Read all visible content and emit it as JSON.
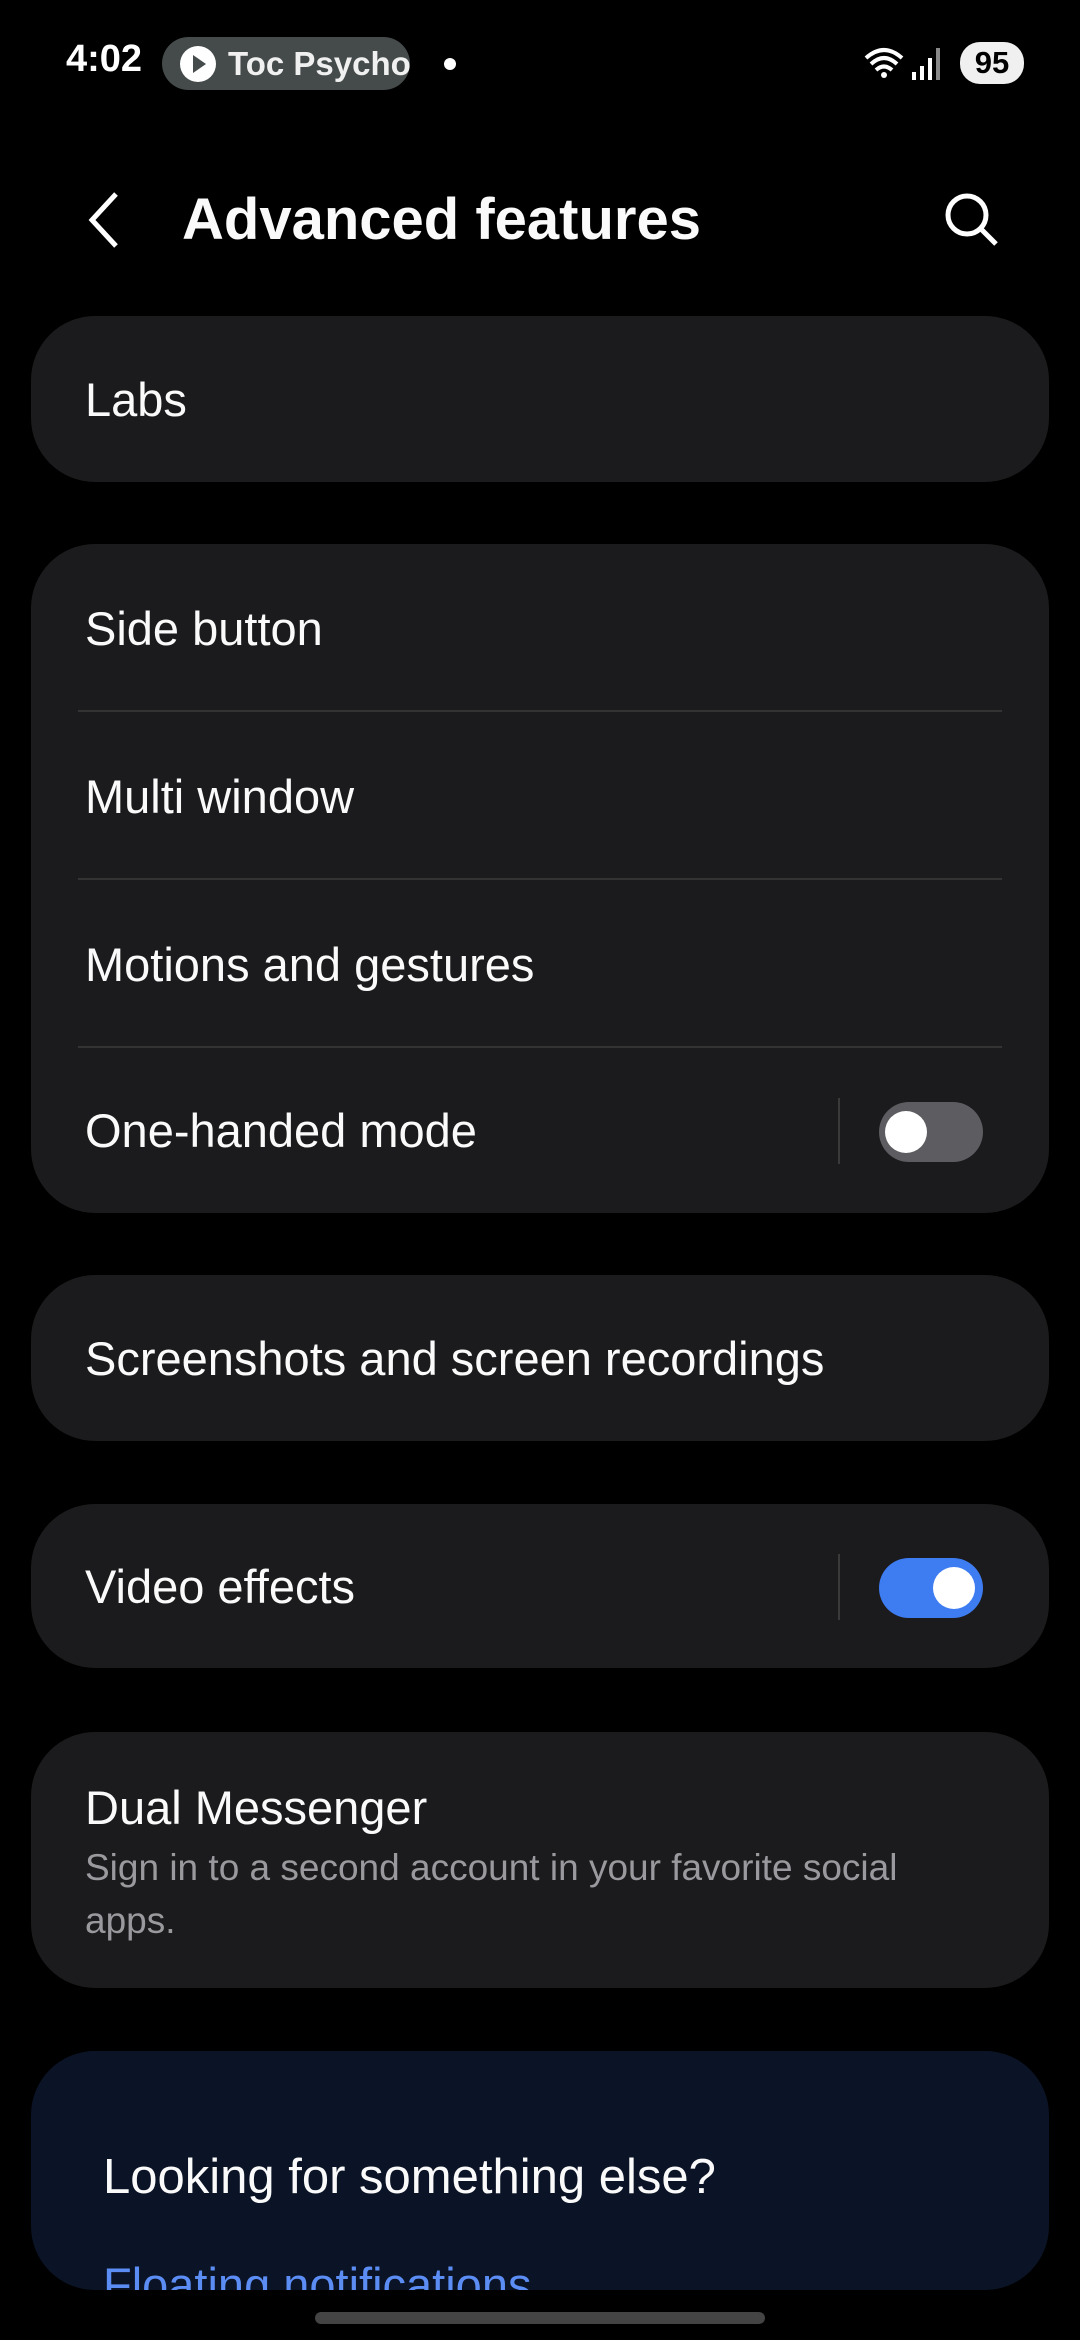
{
  "status_bar": {
    "time": "4:02",
    "media_title": "Toc Psycho",
    "battery": "95"
  },
  "header": {
    "title": "Advanced features"
  },
  "items": {
    "labs": "Labs",
    "side_button": "Side button",
    "multi_window": "Multi window",
    "motions": "Motions and gestures",
    "one_handed": {
      "label": "One-handed mode",
      "enabled": false
    },
    "screenshots": "Screenshots and screen recordings",
    "video_effects": {
      "label": "Video effects",
      "enabled": true
    },
    "dual_messenger": {
      "label": "Dual Messenger",
      "description": "Sign in to a second account in your favorite social apps."
    }
  },
  "suggestions": {
    "title": "Looking for something else?",
    "links": [
      "Floating notifications"
    ]
  },
  "colors": {
    "accent": "#3e7cf2",
    "link": "#5b8df5",
    "card": "#1b1b1d",
    "suggest_bg": "#0b1426"
  }
}
